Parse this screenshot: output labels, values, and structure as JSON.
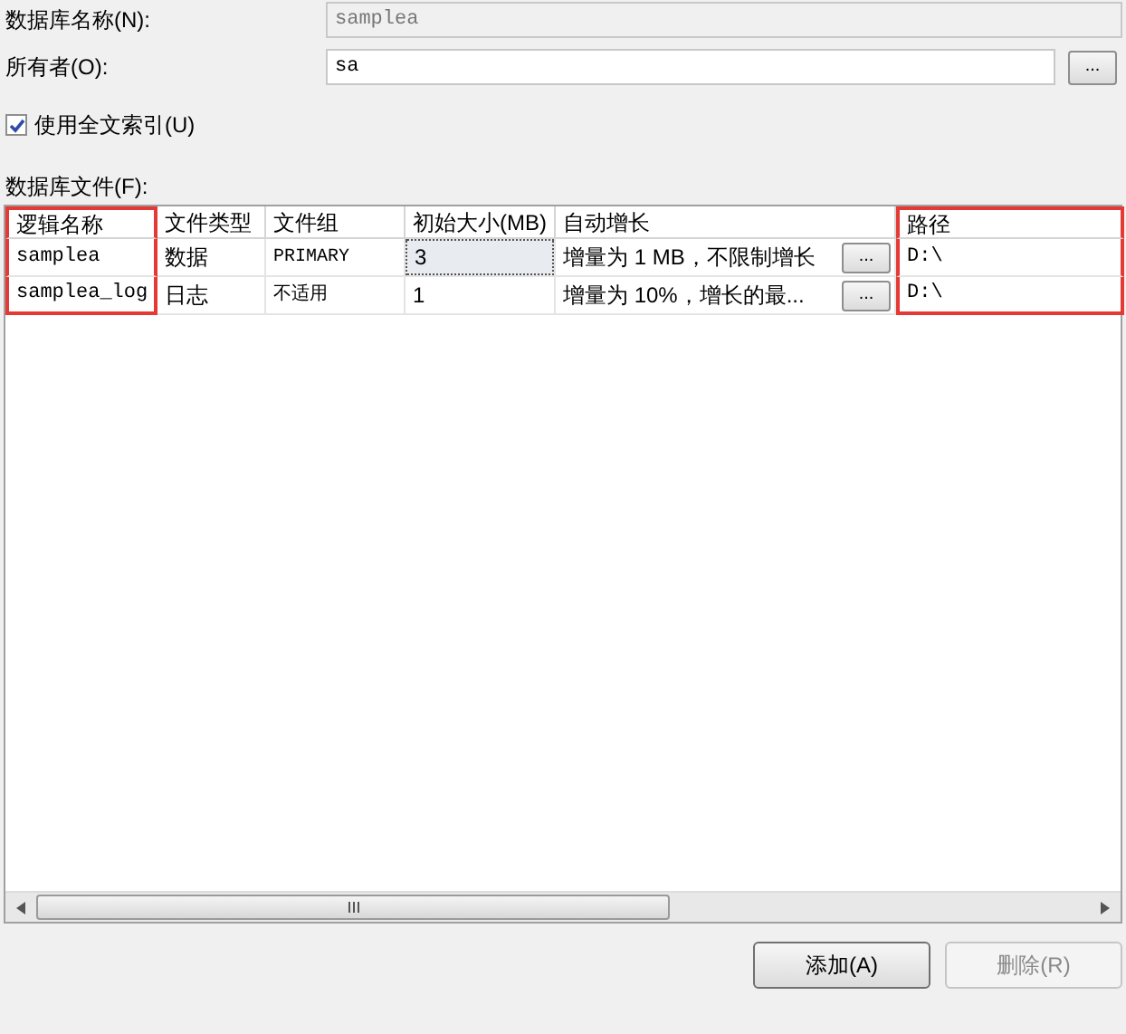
{
  "database_name": {
    "label": "数据库名称(N):",
    "value": "samplea",
    "disabled": true
  },
  "owner": {
    "label": "所有者(O):",
    "value": "sa",
    "button": "..."
  },
  "fulltext": {
    "label": "使用全文索引(U)",
    "checked": true
  },
  "files": {
    "label": "数据库文件(F):",
    "columns": [
      {
        "label": "逻辑名称",
        "highlighted": true
      },
      {
        "label": "文件类型",
        "highlighted": false
      },
      {
        "label": "文件组",
        "highlighted": false
      },
      {
        "label": "初始大小(MB)",
        "highlighted": false
      },
      {
        "label": "自动增长",
        "highlighted": false
      },
      {
        "label": "路径",
        "highlighted": true
      }
    ],
    "rows": [
      {
        "logical_name": "samplea",
        "file_type": "数据",
        "filegroup": "PRIMARY",
        "initial_size": "3",
        "size_focused": true,
        "autogrowth": "增量为 1 MB，不限制增长",
        "autogrowth_button": "...",
        "path": "D:\\"
      },
      {
        "logical_name": "samplea_log",
        "file_type": "日志",
        "filegroup": "不适用",
        "initial_size": "1",
        "size_focused": false,
        "autogrowth": "增量为 10%，增长的最...",
        "autogrowth_button": "...",
        "path": "D:\\"
      }
    ]
  },
  "buttons": [
    {
      "label": "添加(A)",
      "disabled": false
    },
    {
      "label": "删除(R)",
      "disabled": true
    }
  ]
}
